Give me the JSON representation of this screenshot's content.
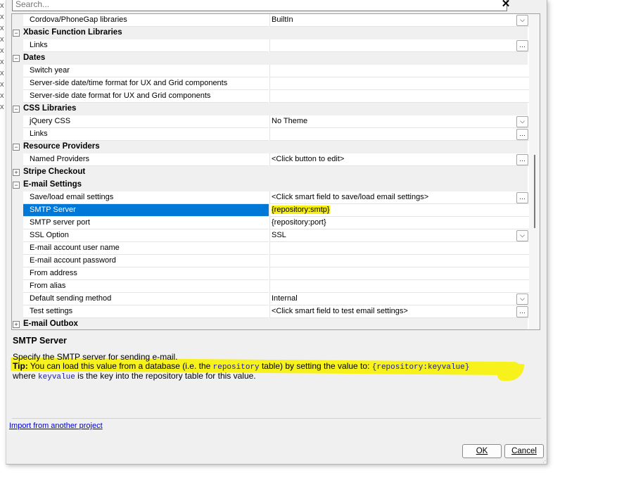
{
  "search": {
    "placeholder": "Search..."
  },
  "close_glyph": "✕",
  "rows": [
    {
      "kind": "prop",
      "name": "Cordova/PhoneGap libraries",
      "value": "BuiltIn",
      "btn": "dropdown"
    },
    {
      "kind": "cat",
      "name": "Xbasic Function Libraries",
      "toggle": "−"
    },
    {
      "kind": "prop",
      "name": "Links",
      "value": "",
      "btn": "ellipsis"
    },
    {
      "kind": "cat",
      "name": "Dates",
      "toggle": "−"
    },
    {
      "kind": "prop",
      "name": "Switch year",
      "value": ""
    },
    {
      "kind": "prop",
      "name": "Server-side date/time format for UX and Grid components",
      "value": ""
    },
    {
      "kind": "prop",
      "name": "Server-side date format for UX and Grid components",
      "value": ""
    },
    {
      "kind": "cat",
      "name": "CSS Libraries",
      "toggle": "−"
    },
    {
      "kind": "prop",
      "name": "jQuery CSS",
      "value": "No Theme",
      "btn": "dropdown"
    },
    {
      "kind": "prop",
      "name": "Links",
      "value": "",
      "btn": "ellipsis"
    },
    {
      "kind": "cat",
      "name": "Resource Providers",
      "toggle": "−"
    },
    {
      "kind": "prop",
      "name": "Named Providers",
      "value": "<Click button to edit>",
      "btn": "ellipsis"
    },
    {
      "kind": "cat",
      "name": "Stripe Checkout",
      "toggle": "+"
    },
    {
      "kind": "cat",
      "name": "E-mail Settings",
      "toggle": "−"
    },
    {
      "kind": "prop",
      "name": "Save/load email settings",
      "value": "<Click smart field to save/load email settings>",
      "btn": "ellipsis"
    },
    {
      "kind": "prop",
      "name": "SMTP Server",
      "value": "{repository:smtp}",
      "selected": true
    },
    {
      "kind": "prop",
      "name": "SMTP server port",
      "value": "{repository:port}"
    },
    {
      "kind": "prop",
      "name": "SSL Option",
      "value": "SSL",
      "btn": "dropdown"
    },
    {
      "kind": "prop",
      "name": "E-mail account user name",
      "value": ""
    },
    {
      "kind": "prop",
      "name": "E-mail account password",
      "value": ""
    },
    {
      "kind": "prop",
      "name": "From address",
      "value": ""
    },
    {
      "kind": "prop",
      "name": "From alias",
      "value": ""
    },
    {
      "kind": "prop",
      "name": "Default sending method",
      "value": "Internal",
      "btn": "dropdown"
    },
    {
      "kind": "prop",
      "name": "Test settings",
      "value": "<Click smart field to test email settings>",
      "btn": "ellipsis"
    },
    {
      "kind": "cat",
      "name": "E-mail Outbox",
      "toggle": "+"
    }
  ],
  "icons": {
    "dropdown": "chevron-down-icon",
    "ellipsis": "ellipsis-icon",
    "expand": "plus-icon",
    "collapse": "minus-icon"
  },
  "help": {
    "title": "SMTP Server",
    "line1": "Specify the SMTP server for sending e-mail.",
    "tip_label": "Tip:",
    "tip_a": " You can load this value from a database (i.e. the ",
    "tip_code1": "repository",
    "tip_b": " table) by setting the value to: ",
    "tip_code2": "{repository:keyvalue}",
    "line3_a": "where ",
    "line3_code": "keyvalue",
    "line3_b": " is the key into the repository table for this value."
  },
  "import_link": "Import from another project",
  "buttons": {
    "ok": "OK",
    "cancel": "Cancel"
  },
  "colors": {
    "selection": "#0078d7",
    "highlight": "#f7ef12",
    "link": "#0000cc"
  }
}
